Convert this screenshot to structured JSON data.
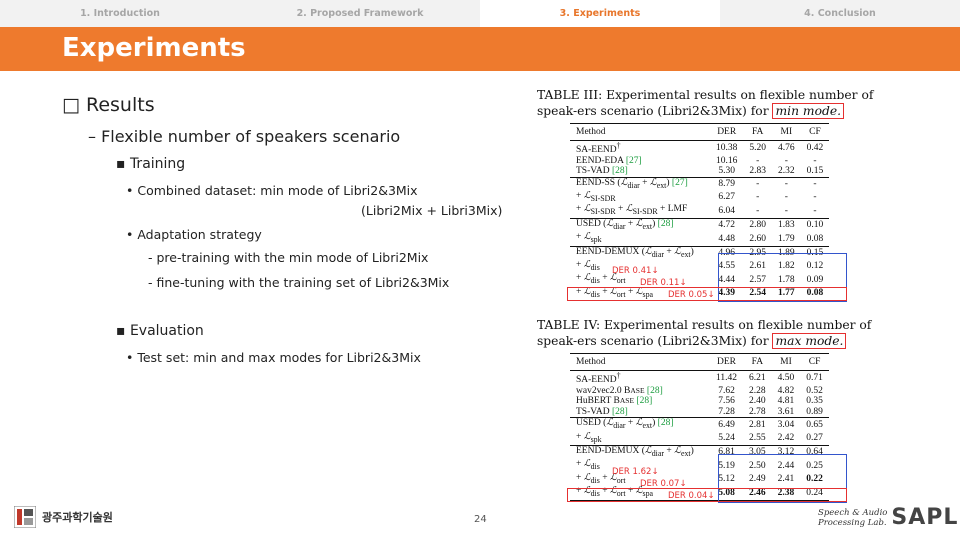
{
  "nav": {
    "tabs": [
      {
        "label": "1. Introduction"
      },
      {
        "label": "2. Proposed Framework"
      },
      {
        "label": "3. Experiments",
        "active": true
      },
      {
        "label": "4. Conclusion"
      }
    ]
  },
  "title": "Experiments",
  "bullets": {
    "l0": "□ Results",
    "l1": "– Flexible number of speakers scenario",
    "training": "▪  Training",
    "combined": "•    Combined dataset: min mode of Libri2&3Mix",
    "combined_sub": "(Libri2Mix + Libri3Mix)",
    "adaptation": "•    Adaptation strategy",
    "pretrain": "-    pre-training with the min mode of Libri2Mix",
    "finetune": "-    fine-tuning with the training set of Libri2&3Mix",
    "evaluation": "▪  Evaluation",
    "testset": "•    Test set:  min and max modes for Libri2&3Mix"
  },
  "table3": {
    "caption_pre": "TABLE III: Experimental results on flexible number of speak-ers scenario (Libri2&3Mix) for ",
    "caption_mode": "min mode.",
    "headers": [
      "Method",
      "DER",
      "FA",
      "MI",
      "CF"
    ],
    "annotations": [
      "DER 0.41↓",
      "DER 0.11↓",
      "DER 0.05↓"
    ]
  },
  "table4": {
    "caption_pre": "TABLE IV: Experimental results on flexible number of speak-ers scenario (Libri2&3Mix) for ",
    "caption_mode": "max mode.",
    "headers": [
      "Method",
      "DER",
      "FA",
      "MI",
      "CF"
    ],
    "annotations": [
      "DER 1.62↓",
      "DER 0.07↓",
      "DER 0.04↓"
    ]
  },
  "footer": {
    "page": "24",
    "lab_line1": "Speech & Audio",
    "lab_line2": "Processing Lab.",
    "lab_logo": "SAPL",
    "univ_logo": "광주과학기술원"
  },
  "colors": {
    "accent": "#ee7a2d",
    "annotation": "#e53030",
    "citation": "#1a9c3e",
    "box_blue": "#3355cc"
  }
}
